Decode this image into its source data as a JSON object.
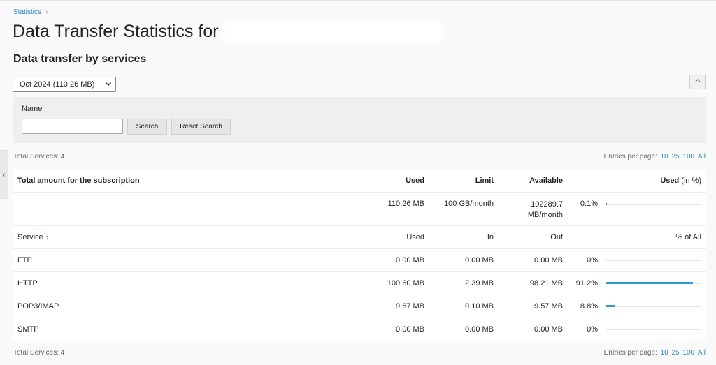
{
  "breadcrumb": {
    "item": "Statistics",
    "separator": "›"
  },
  "page": {
    "title": "Data Transfer Statistics for",
    "section_title": "Data transfer by services"
  },
  "period_select": {
    "value": "Oct 2024 (110.26 MB)"
  },
  "collapse_button": {
    "icon": "chevron-up-icon",
    "glyph": "⌃"
  },
  "side_tab": {
    "icon": "chevron-left-icon",
    "glyph": "‹"
  },
  "search": {
    "name_label": "Name",
    "name_value": "",
    "search_label": "Search",
    "reset_label": "Reset Search"
  },
  "pagination": {
    "total_services": "Total Services: 4",
    "entries_label": "Entries per page:",
    "options": [
      "10",
      "25",
      "100",
      "All"
    ]
  },
  "subscription": {
    "headers": {
      "title": "Total amount for the subscription",
      "used": "Used",
      "limit": "Limit",
      "available": "Available",
      "used_pct_bold": "Used",
      "used_pct_rest": " (in %)"
    },
    "values": {
      "used": "110.26 MB",
      "limit": "100 GB/month",
      "available_line1": "102289.7",
      "available_line2": "MB/month",
      "percent": "0.1%",
      "fraction": 0.001
    }
  },
  "services": {
    "headers": {
      "service": "Service",
      "sort_arrow": "↑",
      "used": "Used",
      "in": "In",
      "out": "Out",
      "pct_all": "% of All"
    },
    "rows": [
      {
        "name": "FTP",
        "used": "0.00 MB",
        "in": "0.00 MB",
        "out": "0.00 MB",
        "percent": "0%",
        "fraction": 0.0
      },
      {
        "name": "HTTP",
        "used": "100.60 MB",
        "in": "2.39 MB",
        "out": "98.21 MB",
        "percent": "91.2%",
        "fraction": 0.912
      },
      {
        "name": "POP3/IMAP",
        "used": "9.67 MB",
        "in": "0.10 MB",
        "out": "9.57 MB",
        "percent": "8.8%",
        "fraction": 0.088
      },
      {
        "name": "SMTP",
        "used": "0.00 MB",
        "in": "0.00 MB",
        "out": "0.00 MB",
        "percent": "0%",
        "fraction": 0.0
      }
    ]
  },
  "colors": {
    "accent": "#2b8ac4",
    "bar": "#2b9bd1"
  }
}
